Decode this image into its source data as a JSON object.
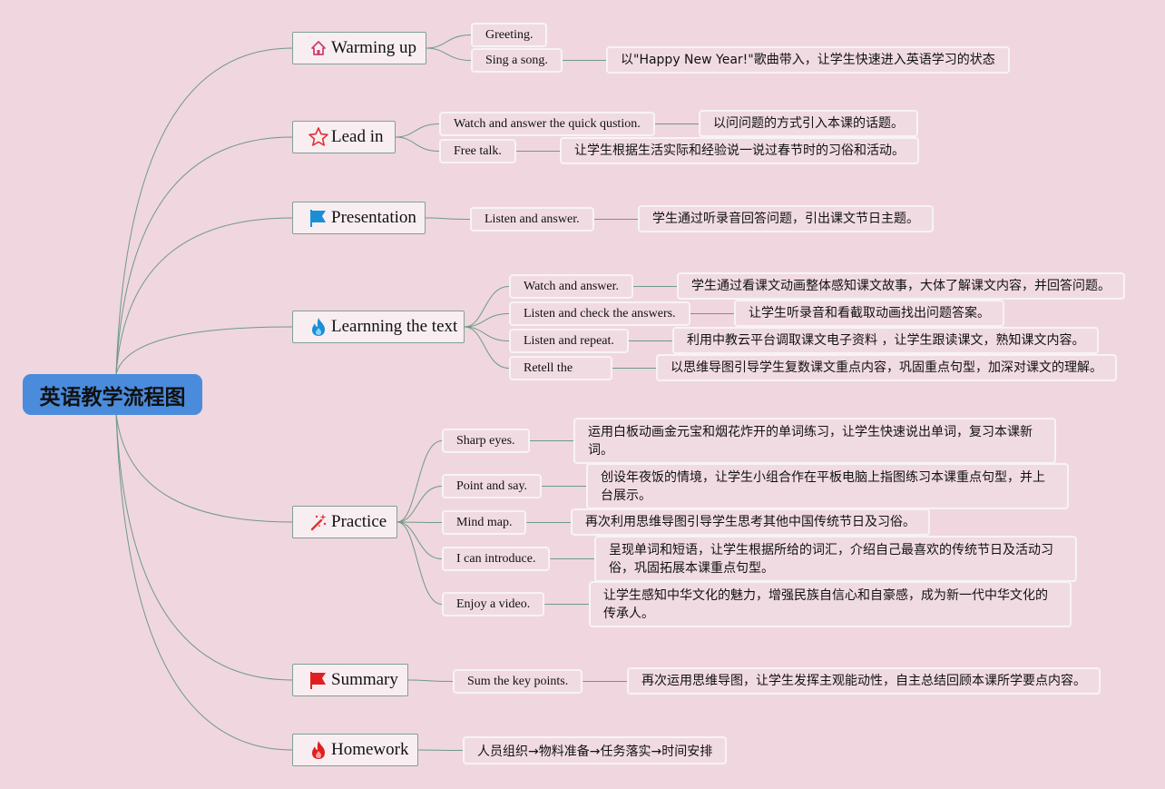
{
  "title": "英语教学流程图",
  "sections": [
    {
      "label": "Warming up",
      "icon": "house-icon",
      "items": [
        {
          "label": "Greeting.",
          "desc": ""
        },
        {
          "label": "Sing a song.",
          "desc": "以\"Happy New Year!\"歌曲带入，让学生快速进入英语学习的状态"
        }
      ]
    },
    {
      "label": "Lead in",
      "icon": "star-icon",
      "items": [
        {
          "label": "Watch and answer the quick qustion.",
          "desc": "以问问题的方式引入本课的话题。"
        },
        {
          "label": "Free talk.",
          "desc": "让学生根据生活实际和经验说一说过春节时的习俗和活动。"
        }
      ]
    },
    {
      "label": "Presentation",
      "icon": "blue-flag-icon",
      "items": [
        {
          "label": "Listen and answer.",
          "desc": "学生通过听录音回答问题，引出课文节日主题。"
        }
      ]
    },
    {
      "label": "Learnning the text",
      "icon": "blue-flame-icon",
      "items": [
        {
          "label": "Watch and answer.",
          "desc": "学生通过看课文动画整体感知课文故事，大体了解课文内容，并回答问题。"
        },
        {
          "label": "Listen and check the answers.",
          "desc": "让学生听录音和看截取动画找出问题答案。"
        },
        {
          "label": "Listen and repeat.",
          "desc": "利用中教云平台调取课文电子资料 ，让学生跟读课文，熟知课文内容。"
        },
        {
          "label": "Retell the",
          "desc": "以思维导图引导学生复数课文重点内容，巩固重点句型，加深对课文的理解。"
        }
      ]
    },
    {
      "label": "Practice",
      "icon": "magic-wand-icon",
      "items": [
        {
          "label": "Sharp eyes.",
          "desc": "运用白板动画金元宝和烟花炸开的单词练习，让学生快速说出单词，复习本课新词。"
        },
        {
          "label": "Point and say.",
          "desc": "创设年夜饭的情境，让学生小组合作在平板电脑上指图练习本课重点句型，并上台展示。"
        },
        {
          "label": "Mind map.",
          "desc": "再次利用思维导图引导学生思考其他中国传统节日及习俗。"
        },
        {
          "label": "I can introduce.",
          "desc": "呈现单词和短语，让学生根据所给的词汇，介绍自己最喜欢的传统节日及活动习俗，巩固拓展本课重点句型。"
        },
        {
          "label": "Enjoy a video.",
          "desc": "让学生感知中华文化的魅力，增强民族自信心和自豪感，成为新一代中华文化的传承人。"
        }
      ]
    },
    {
      "label": "Summary",
      "icon": "red-flag-icon",
      "items": [
        {
          "label": "Sum the key points.",
          "desc": "再次运用思维导图，让学生发挥主观能动性，自主总结回顾本课所学要点内容。"
        }
      ]
    },
    {
      "label": "Homework",
      "icon": "red-flame-icon",
      "items": [
        {
          "label": "人员组织→物料准备→任务落实→时间安排",
          "desc": ""
        }
      ]
    }
  ],
  "colors": {
    "background": "#f0d6df",
    "root": "#4a8bdc",
    "connector": "#6e9a86"
  }
}
